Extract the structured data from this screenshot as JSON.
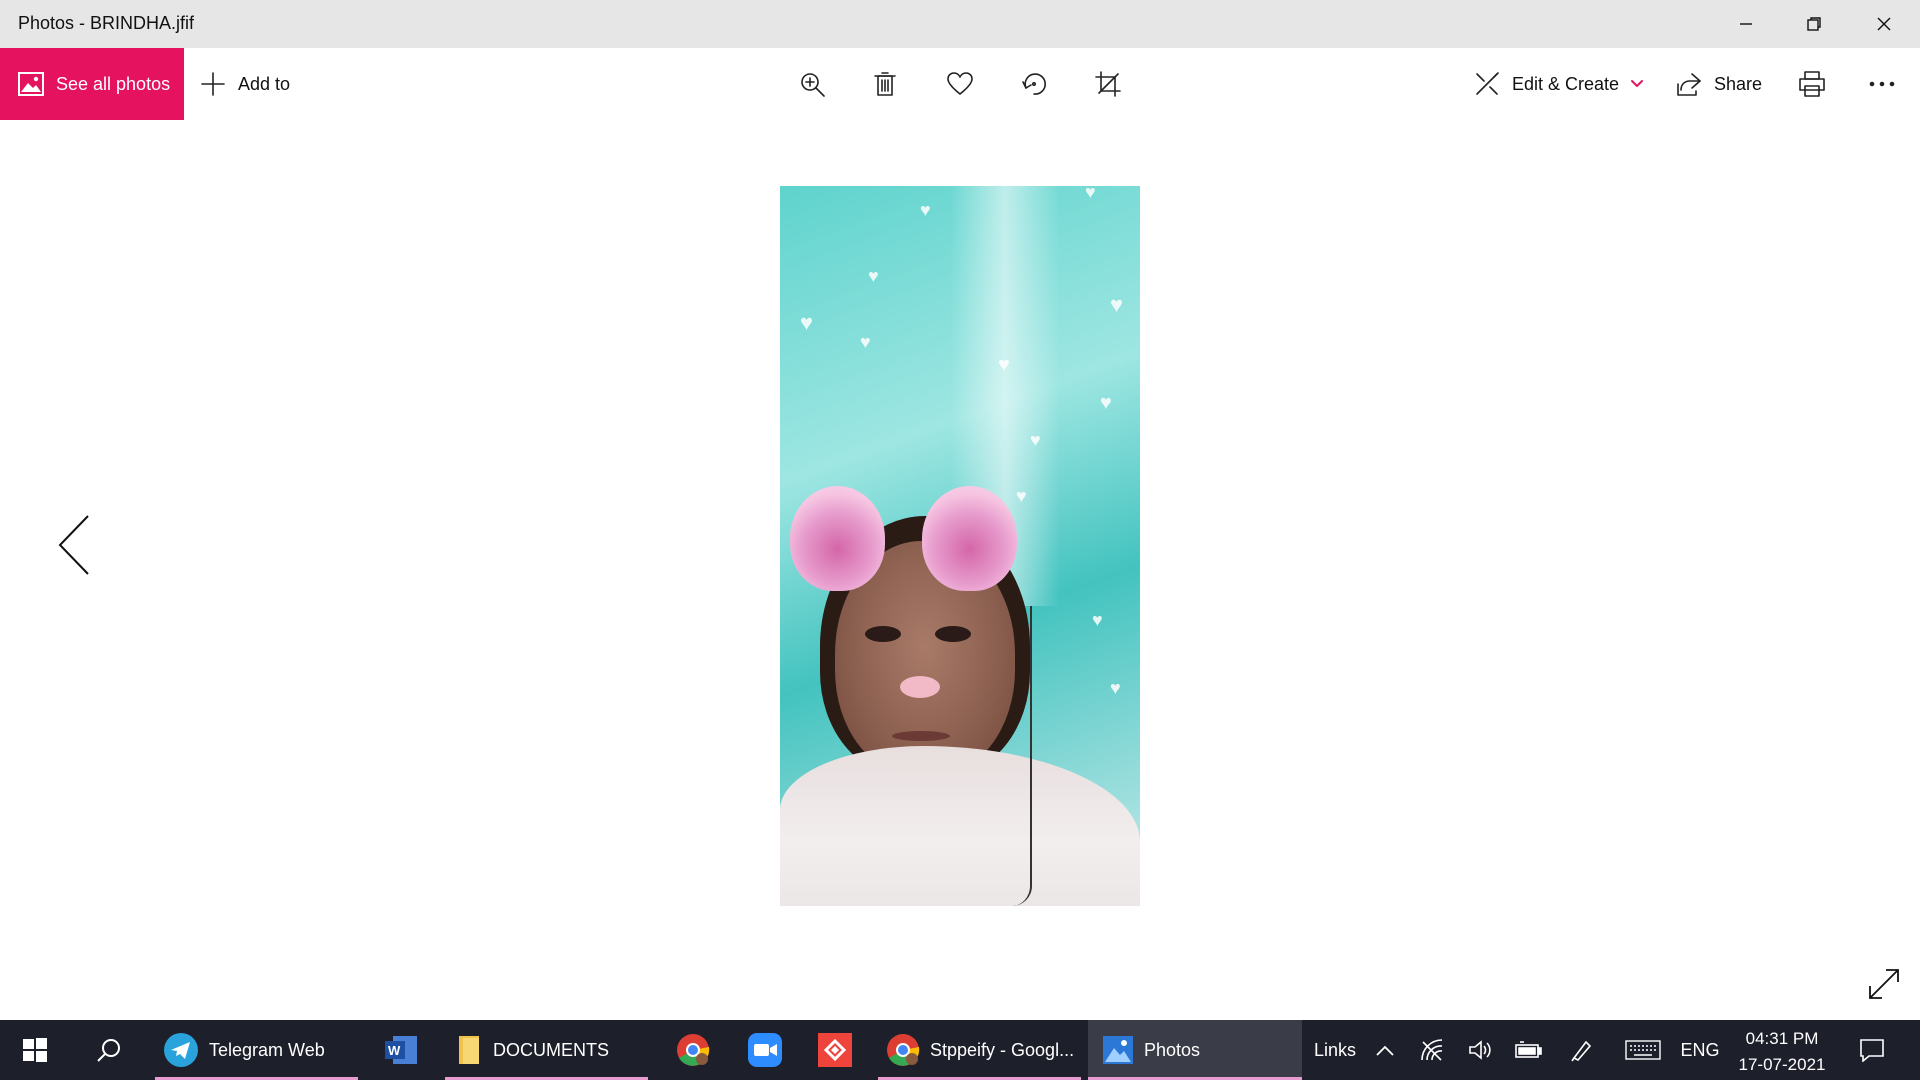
{
  "window": {
    "title": "Photos - BRINDHA.jfif"
  },
  "toolbar": {
    "see_all_label": "See all photos",
    "add_to_label": "Add to",
    "edit_create_label": "Edit & Create",
    "share_label": "Share"
  },
  "colors": {
    "accent": "#e5135f",
    "taskbar": "#1d1f2a",
    "taskbar_underline": "#e79bd0"
  },
  "taskbar": {
    "apps": [
      {
        "label": "Telegram Web"
      },
      {
        "label": "DOCUMENTS"
      },
      {
        "label": "Stppeify - Googl..."
      },
      {
        "label": "Photos"
      }
    ],
    "links_label": "Links",
    "language": "ENG",
    "time": "04:31 PM",
    "date": "17-07-2021"
  },
  "icons": [
    "picture-icon",
    "plus-icon",
    "zoom-in-icon",
    "trash-icon",
    "heart-icon",
    "rotate-icon",
    "crop-icon",
    "edit-create-icon",
    "chevron-down-icon",
    "share-icon",
    "print-icon",
    "more-icon",
    "chevron-left-icon",
    "fullscreen-icon",
    "windows-start-icon",
    "search-icon"
  ]
}
